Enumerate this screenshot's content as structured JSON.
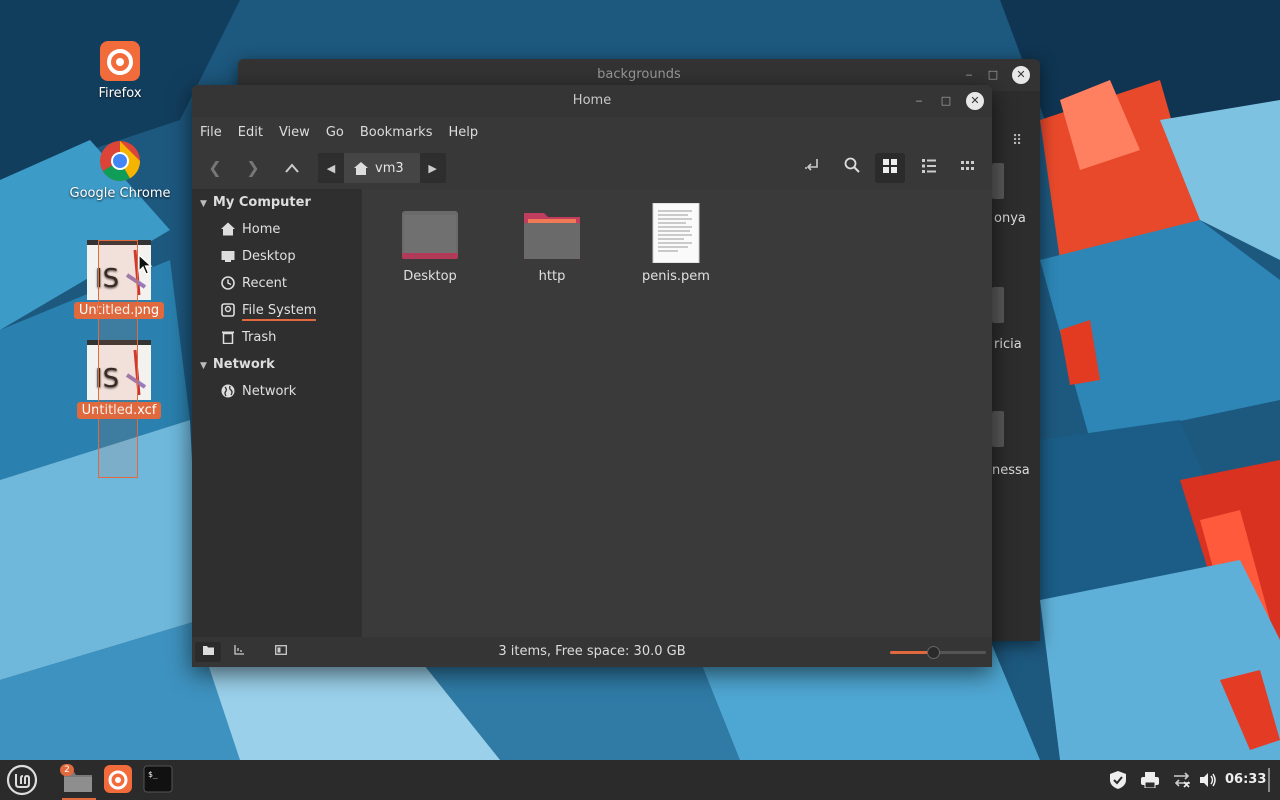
{
  "desktop": {
    "icons": [
      {
        "label": "Firefox"
      },
      {
        "label": "Google Chrome"
      },
      {
        "label": "Untitled.png"
      },
      {
        "label": "Untitled.xcf"
      }
    ]
  },
  "back_window": {
    "title": "backgrounds",
    "partial_labels": [
      "onya",
      "ricia",
      "nessa"
    ]
  },
  "window": {
    "title": "Home",
    "menu": [
      "File",
      "Edit",
      "View",
      "Go",
      "Bookmarks",
      "Help"
    ],
    "path": {
      "crumb": "vm3"
    },
    "sidebar": {
      "sections": [
        {
          "title": "My Computer",
          "items": [
            "Home",
            "Desktop",
            "Recent",
            "File System",
            "Trash"
          ]
        },
        {
          "title": "Network",
          "items": [
            "Network"
          ]
        }
      ]
    },
    "files": [
      {
        "name": "Desktop",
        "icon": "folder-desktop-icon"
      },
      {
        "name": "http",
        "icon": "folder-icon"
      },
      {
        "name": "penis.pem",
        "icon": "text-document-icon"
      }
    ],
    "status": "3 items, Free space: 30.0 GB",
    "zoom_level": 0.45
  },
  "taskbar": {
    "badge": "2",
    "clock": "06:33"
  },
  "colors": {
    "accent": "#e0693e",
    "window_bg": "#383838",
    "sidebar_bg": "#2f2f2f",
    "taskbar_bg": "#2b2b2b"
  }
}
